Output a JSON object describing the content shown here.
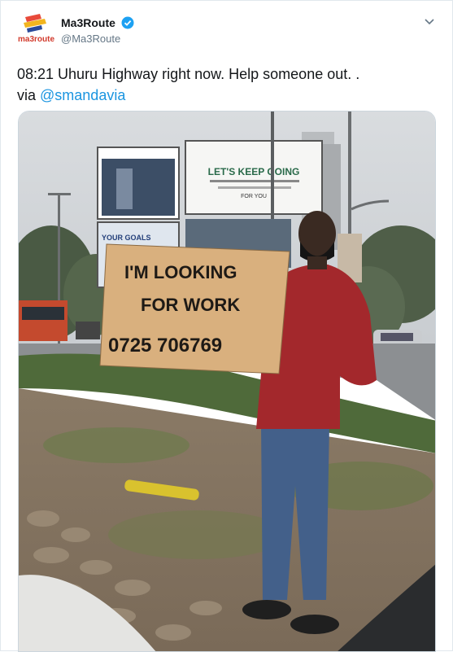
{
  "account": {
    "display_name": "Ma3Route",
    "handle": "@Ma3Route",
    "logo_text": "ma3route"
  },
  "tweet": {
    "text_main": "08:21 Uhuru Highway right now. Help someone out.  .",
    "text_via": "via ",
    "mention": "@smandavia"
  },
  "photo": {
    "sign_line1": "I'M  LOOKING",
    "sign_line2": "FOR  WORK",
    "sign_line3": "0725 706769",
    "billboard_main": "LET'S KEEP GOING",
    "billboard_sub": "FOR YOU",
    "billboard_left": "YOUR GOALS"
  },
  "colors": {
    "accent": "#1b95e0",
    "verified": "#1da1f2",
    "jacket": "#a3282c"
  }
}
